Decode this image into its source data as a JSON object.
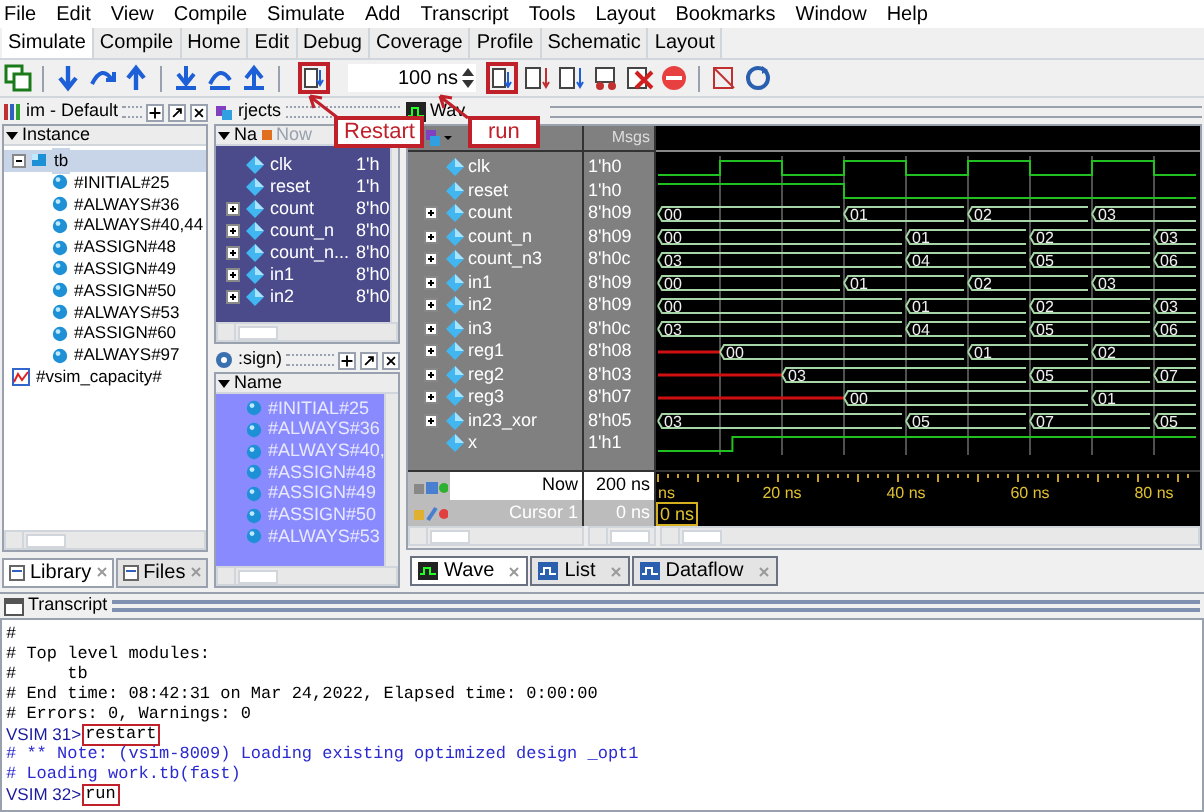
{
  "menu": [
    "File",
    "Edit",
    "View",
    "Compile",
    "Simulate",
    "Add",
    "Transcript",
    "Tools",
    "Layout",
    "Bookmarks",
    "Window",
    "Help"
  ],
  "tabs": [
    {
      "label": "Simulate",
      "selected": true
    },
    {
      "label": "Compile",
      "selected": false
    },
    {
      "label": "Home",
      "selected": false
    },
    {
      "label": "Edit",
      "selected": false
    },
    {
      "label": "Debug",
      "selected": false
    },
    {
      "label": "Coverage",
      "selected": false
    },
    {
      "label": "Profile",
      "selected": false
    },
    {
      "label": "Schematic",
      "selected": false
    },
    {
      "label": "Layout",
      "selected": false
    }
  ],
  "toolbar": {
    "run_length": "100 ns"
  },
  "callouts": [
    {
      "label": "Restart"
    },
    {
      "label": "run"
    }
  ],
  "sim_panel": {
    "title": "im - Default",
    "header": "Instance",
    "tree": [
      {
        "label": "tb",
        "expanded": true,
        "selected": true,
        "children": [
          {
            "label": "#INITIAL#25"
          },
          {
            "label": "#ALWAYS#36"
          },
          {
            "label": "#ALWAYS#40,44"
          },
          {
            "label": "#ASSIGN#48"
          },
          {
            "label": "#ASSIGN#49"
          },
          {
            "label": "#ASSIGN#50"
          },
          {
            "label": "#ALWAYS#53"
          },
          {
            "label": "#ASSIGN#60"
          },
          {
            "label": "#ALWAYS#97"
          }
        ]
      },
      {
        "label": "#vsim_capacity#",
        "selected": false
      }
    ],
    "tabs": [
      {
        "label": "Library",
        "selected": true
      },
      {
        "label": "Files",
        "selected": false
      }
    ]
  },
  "objects_panel": {
    "title": "rjects",
    "columns": [
      "Na",
      "Now"
    ],
    "rows": [
      {
        "name": "clk",
        "value": "1'h",
        "expandable": false
      },
      {
        "name": "reset",
        "value": "1'h",
        "expandable": false
      },
      {
        "name": "count",
        "value": "8'h0",
        "expandable": true
      },
      {
        "name": "count_n",
        "value": "8'h0",
        "expandable": true
      },
      {
        "name": "count_n...",
        "value": "8'h0",
        "expandable": true
      },
      {
        "name": "in1",
        "value": "8'h0",
        "expandable": true
      },
      {
        "name": "in2",
        "value": "8'h0",
        "expandable": true
      }
    ]
  },
  "processes_panel": {
    "title": ":sign)",
    "header": "Name",
    "rows": [
      "#INITIAL#25",
      "#ALWAYS#36",
      "#ALWAYS#40,",
      "#ASSIGN#48",
      "#ASSIGN#49",
      "#ASSIGN#50",
      "#ALWAYS#53"
    ]
  },
  "wave": {
    "title": "Wav",
    "msgs_header": "Msgs",
    "signals": [
      {
        "name": "clk",
        "value": "1'h0",
        "kind": "clock",
        "expandable": false
      },
      {
        "name": "reset",
        "value": "1'h0",
        "kind": "falling",
        "expandable": false
      },
      {
        "name": "count",
        "value": "8'h09",
        "kind": "bus",
        "expandable": true,
        "starts_unknown": false,
        "labels": [
          "00",
          "01",
          "02",
          "03"
        ]
      },
      {
        "name": "count_n",
        "value": "8'h09",
        "kind": "bus",
        "expandable": true,
        "starts_unknown": false,
        "labels": [
          "00",
          "01",
          "02",
          "03"
        ]
      },
      {
        "name": "count_n3",
        "value": "8'h0c",
        "kind": "bus",
        "expandable": true,
        "starts_unknown": false,
        "labels": [
          "03",
          "04",
          "05",
          "06"
        ]
      },
      {
        "name": "in1",
        "value": "8'h09",
        "kind": "bus",
        "expandable": true,
        "starts_unknown": false,
        "labels": [
          "00",
          "01",
          "02",
          "03"
        ]
      },
      {
        "name": "in2",
        "value": "8'h09",
        "kind": "bus",
        "expandable": true,
        "starts_unknown": false,
        "labels": [
          "00",
          "01",
          "02",
          "03"
        ]
      },
      {
        "name": "in3",
        "value": "8'h0c",
        "kind": "bus",
        "expandable": true,
        "starts_unknown": false,
        "labels": [
          "03",
          "04",
          "05",
          "06"
        ]
      },
      {
        "name": "reg1",
        "value": "8'h08",
        "kind": "bus",
        "expandable": true,
        "starts_unknown": true,
        "labels": [
          "00",
          "01",
          "02"
        ]
      },
      {
        "name": "reg2",
        "value": "8'h03",
        "kind": "bus",
        "expandable": true,
        "starts_unknown": true,
        "labels": [
          "03",
          "05",
          "07"
        ]
      },
      {
        "name": "reg3",
        "value": "8'h07",
        "kind": "bus",
        "expandable": true,
        "starts_unknown": true,
        "labels": [
          "00",
          "01"
        ]
      },
      {
        "name": "in23_xor",
        "value": "8'h05",
        "kind": "bus",
        "expandable": true,
        "starts_unknown": false,
        "labels": [
          "03",
          "05",
          "07",
          "05"
        ]
      },
      {
        "name": "x",
        "value": "1'h1",
        "kind": "rising",
        "expandable": false
      }
    ],
    "now_label": "Now",
    "now_value": "200 ns",
    "cursor_label": "Cursor 1",
    "cursor_value": "0 ns",
    "cursor_time": "0 ns",
    "time_labels": [
      "ns",
      "20 ns",
      "40 ns",
      "60 ns",
      "80 ns"
    ],
    "tabs": [
      {
        "label": "Wave",
        "selected": true
      },
      {
        "label": "List",
        "selected": false
      },
      {
        "label": "Dataflow",
        "selected": false
      }
    ]
  },
  "transcript": {
    "title": "Transcript",
    "lines": [
      {
        "kind": "output",
        "text": "#"
      },
      {
        "kind": "output",
        "text": "# Top level modules:"
      },
      {
        "kind": "output",
        "text": "#     tb"
      },
      {
        "kind": "output",
        "text": "# End time: 08:42:31 on Mar 24,2022, Elapsed time: 0:00:00"
      },
      {
        "kind": "output",
        "text": "# Errors: 0, Warnings: 0"
      },
      {
        "kind": "prompt",
        "prompt": "VSIM 31>",
        "command": "restart",
        "boxed": true
      },
      {
        "kind": "note",
        "text": "# ** Note: (vsim-8009) Loading existing optimized design _opt1"
      },
      {
        "kind": "note",
        "text": "# Loading work.tb(fast)"
      },
      {
        "kind": "prompt",
        "prompt": "VSIM 32>",
        "command": "run",
        "boxed": true
      }
    ]
  }
}
